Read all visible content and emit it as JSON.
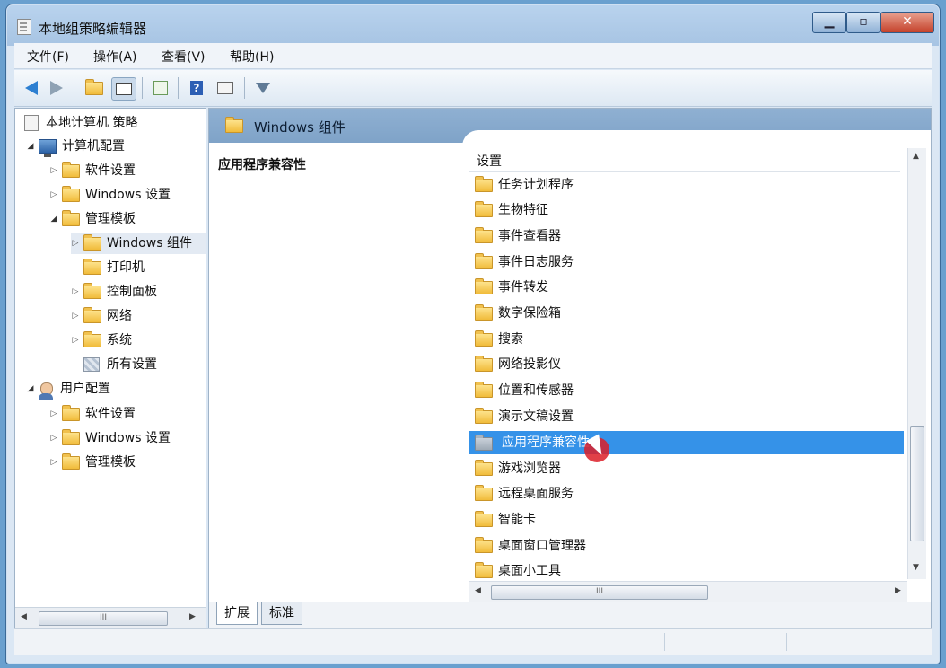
{
  "window": {
    "title": "本地组策略编辑器",
    "controls": {
      "minimize": "▁",
      "maximize": "▫",
      "close": "✕"
    }
  },
  "menu": [
    "文件(F)",
    "操作(A)",
    "查看(V)",
    "帮助(H)"
  ],
  "tree": {
    "root": "本地计算机 策略",
    "computer_config": "计算机配置",
    "computer_children": [
      "软件设置",
      "Windows 设置",
      "管理模板"
    ],
    "admin_children": [
      "Windows 组件",
      "打印机",
      "控制面板",
      "网络",
      "系统",
      "所有设置"
    ],
    "user_config": "用户配置",
    "user_children": [
      "软件设置",
      "Windows 设置",
      "管理模板"
    ]
  },
  "main": {
    "header_title": "Windows 组件",
    "description_title": "应用程序兼容性",
    "column_header": "设置",
    "items": [
      "任务计划程序",
      "生物特征",
      "事件查看器",
      "事件日志服务",
      "事件转发",
      "数字保险箱",
      "搜索",
      "网络投影仪",
      "位置和传感器",
      "演示文稿设置",
      "应用程序兼容性",
      "游戏浏览器",
      "远程桌面服务",
      "智能卡",
      "桌面窗口管理器",
      "桌面小工具"
    ],
    "selected_index": 10,
    "tabs": [
      "扩展",
      "标准"
    ],
    "scroll_thumb_label": "III"
  },
  "colors": {
    "selection": "#3592e8",
    "header": "#7fa3c8",
    "folder": "#f1bb3a"
  }
}
